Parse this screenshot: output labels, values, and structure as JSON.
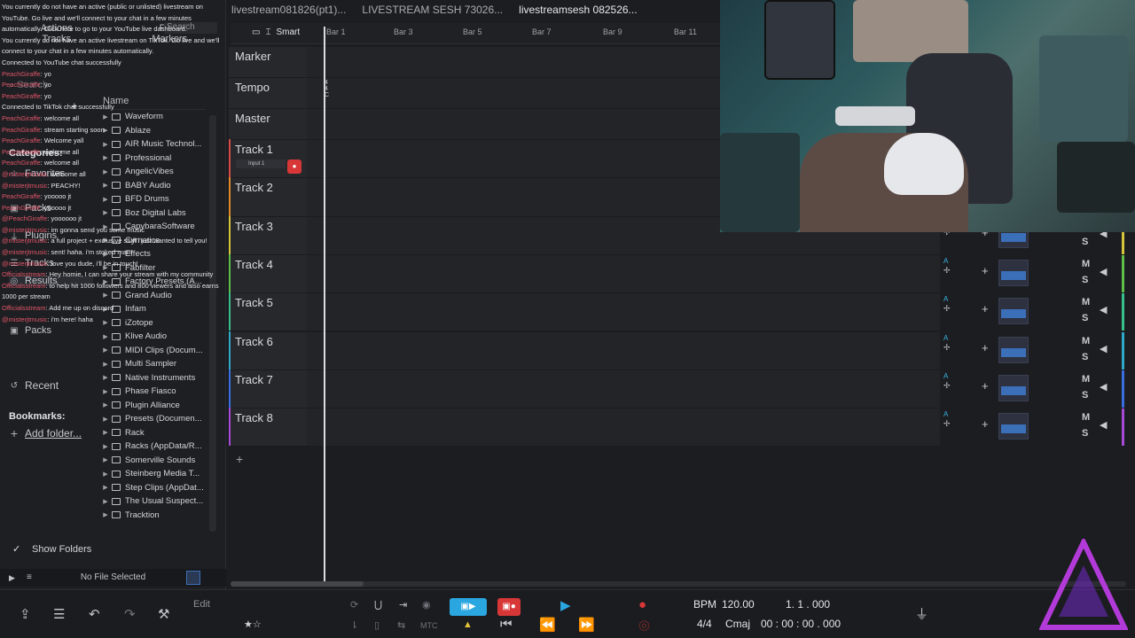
{
  "top_tabs": [
    "livestream081826(pt1)...",
    "LIVESTREAM SESH 73026...",
    "livestreamsesh 082526..."
  ],
  "left_panel": {
    "tabs": [
      "Actions",
      "Files",
      "Tracks",
      "Markers"
    ],
    "search_placeholder": "Search",
    "categories_label": "Categories:",
    "side_items": [
      "Favorites",
      "Packs",
      "Plugins",
      "Tracks",
      "Results",
      "Packs"
    ],
    "recent_label": "Recent",
    "bookmarks_label": "Bookmarks:",
    "add_folder_label": "Add folder...",
    "name_header": "Name",
    "files": [
      "Waveform",
      "Ablaze",
      "AIR Music Technol...",
      "Professional",
      "AngelicVibes",
      "BABY Audio",
      "BFD Drums",
      "Boz Digital Labs",
      "CapybaraSoftware",
      "Cymatics",
      "Effects",
      "Fabfilter",
      "Factory Presets (A...",
      "Grand Audio",
      "Infam",
      "iZotope",
      "Klive Audio",
      "MIDI Clips (Docum...",
      "Multi Sampler",
      "Native Instruments",
      "Phase Fiasco",
      "Plugin Alliance",
      "Presets (Documen...",
      "Rack",
      "Racks (AppData/R...",
      "Somerville Sounds",
      "Steinberg Media T...",
      "Step Clips (AppDat...",
      "The Usual Suspect...",
      "Tracktion"
    ],
    "show_folders_label": "Show Folders",
    "no_file_label": "No File Selected"
  },
  "chat": [
    {
      "user": "",
      "text": "You currently do not have an active (public or unlisted) livestream on YouTube. Go live and we'll connect to your chat in a few minutes automatically. Click here to go to your YouTube live dashboard."
    },
    {
      "user": "",
      "text": "You currently do not have an active livestream on TikTok. Go live and we'll connect to your chat in a few minutes automatically."
    },
    {
      "user": "",
      "text": "Connected to YouTube chat successfully"
    },
    {
      "user": "PeachGiraffe",
      "text": "yo"
    },
    {
      "user": "PeachGiraffe",
      "text": "yo"
    },
    {
      "user": "PeachGiraffe",
      "text": "yo"
    },
    {
      "user": "",
      "text": "Connected to TikTok chat successfully"
    },
    {
      "user": "PeachGiraffe",
      "text": "welcome all"
    },
    {
      "user": "PeachGiraffe",
      "text": "stream starting soon"
    },
    {
      "user": "PeachGiraffe",
      "text": "Welcome yall"
    },
    {
      "user": "PeachGiraffe",
      "text": "welcome all"
    },
    {
      "user": "PeachGiraffe",
      "text": "welcome all"
    },
    {
      "user": "@misterjtmusic",
      "text": "welcome all"
    },
    {
      "user": "@misterjtmusic",
      "text": "PEACHY!"
    },
    {
      "user": "PeachGiraffe",
      "text": "yooooo jt"
    },
    {
      "user": "PeachGiraffe",
      "text": "yooooo jt"
    },
    {
      "user": "@PeachGiraffe",
      "text": "yoooooo jt"
    },
    {
      "user": "@misterjtmusic",
      "text": "im gonna send you some music"
    },
    {
      "user": "@misterjtmusic",
      "text": "a full project + exclusive stuff i just wanted to tell you!"
    },
    {
      "user": "@misterjtmusic",
      "text": "sent! haha. i'm stoked man!"
    },
    {
      "user": "@misterjtmusic",
      "text": "love you dude, i'll be in touch!"
    },
    {
      "user": "Officialsstream",
      "text": "Hey homie, I can share your stream with my community"
    },
    {
      "user": "Officialsstream",
      "text": "to help hit 1000 followers and 800 viewers and also earns 1000 per stream"
    },
    {
      "user": "Officialsstream",
      "text": "Add me up on discord"
    },
    {
      "user": "@misterjtmusic",
      "text": "i'm here! haha"
    }
  ],
  "toolbar": {
    "smart_label": "Smart"
  },
  "ruler": {
    "bars": [
      "Bar 1",
      "Bar 3",
      "Bar 5",
      "Bar 7",
      "Bar 9",
      "Bar 11"
    ]
  },
  "tracks": [
    {
      "name": "Marker",
      "color": ""
    },
    {
      "name": "Tempo",
      "color": ""
    },
    {
      "name": "Master",
      "color": ""
    },
    {
      "name": "Track 1",
      "color": "#d84a4a",
      "input": "Input 1"
    },
    {
      "name": "Track 2",
      "color": "#e08a2c"
    },
    {
      "name": "Track 3",
      "color": "#d6c53a"
    },
    {
      "name": "Track 4",
      "color": "#5ec04a"
    },
    {
      "name": "Track 5",
      "color": "#38c08a"
    },
    {
      "name": "Track 6",
      "color": "#2fa9c9"
    },
    {
      "name": "Track 7",
      "color": "#3a6ee0"
    },
    {
      "name": "Track 8",
      "color": "#a84ad8"
    }
  ],
  "tempo_lane": {
    "sig_top": "4",
    "sig_bottom": "4",
    "key": "C"
  },
  "mixer": {
    "m_label": "M",
    "s_label": "S",
    "a_label": "A"
  },
  "transport": {
    "edit_label": "Edit",
    "bpm_label": "BPM",
    "bpm_value": "120.00",
    "position": "1.  1 . 000",
    "time_sig": "4/4",
    "key": "Cmaj",
    "timecode": "00 : 00 : 00 . 000",
    "mtc_label": "MTC"
  },
  "colors": {
    "accent": "#2aa6e0",
    "record": "#d83737"
  }
}
